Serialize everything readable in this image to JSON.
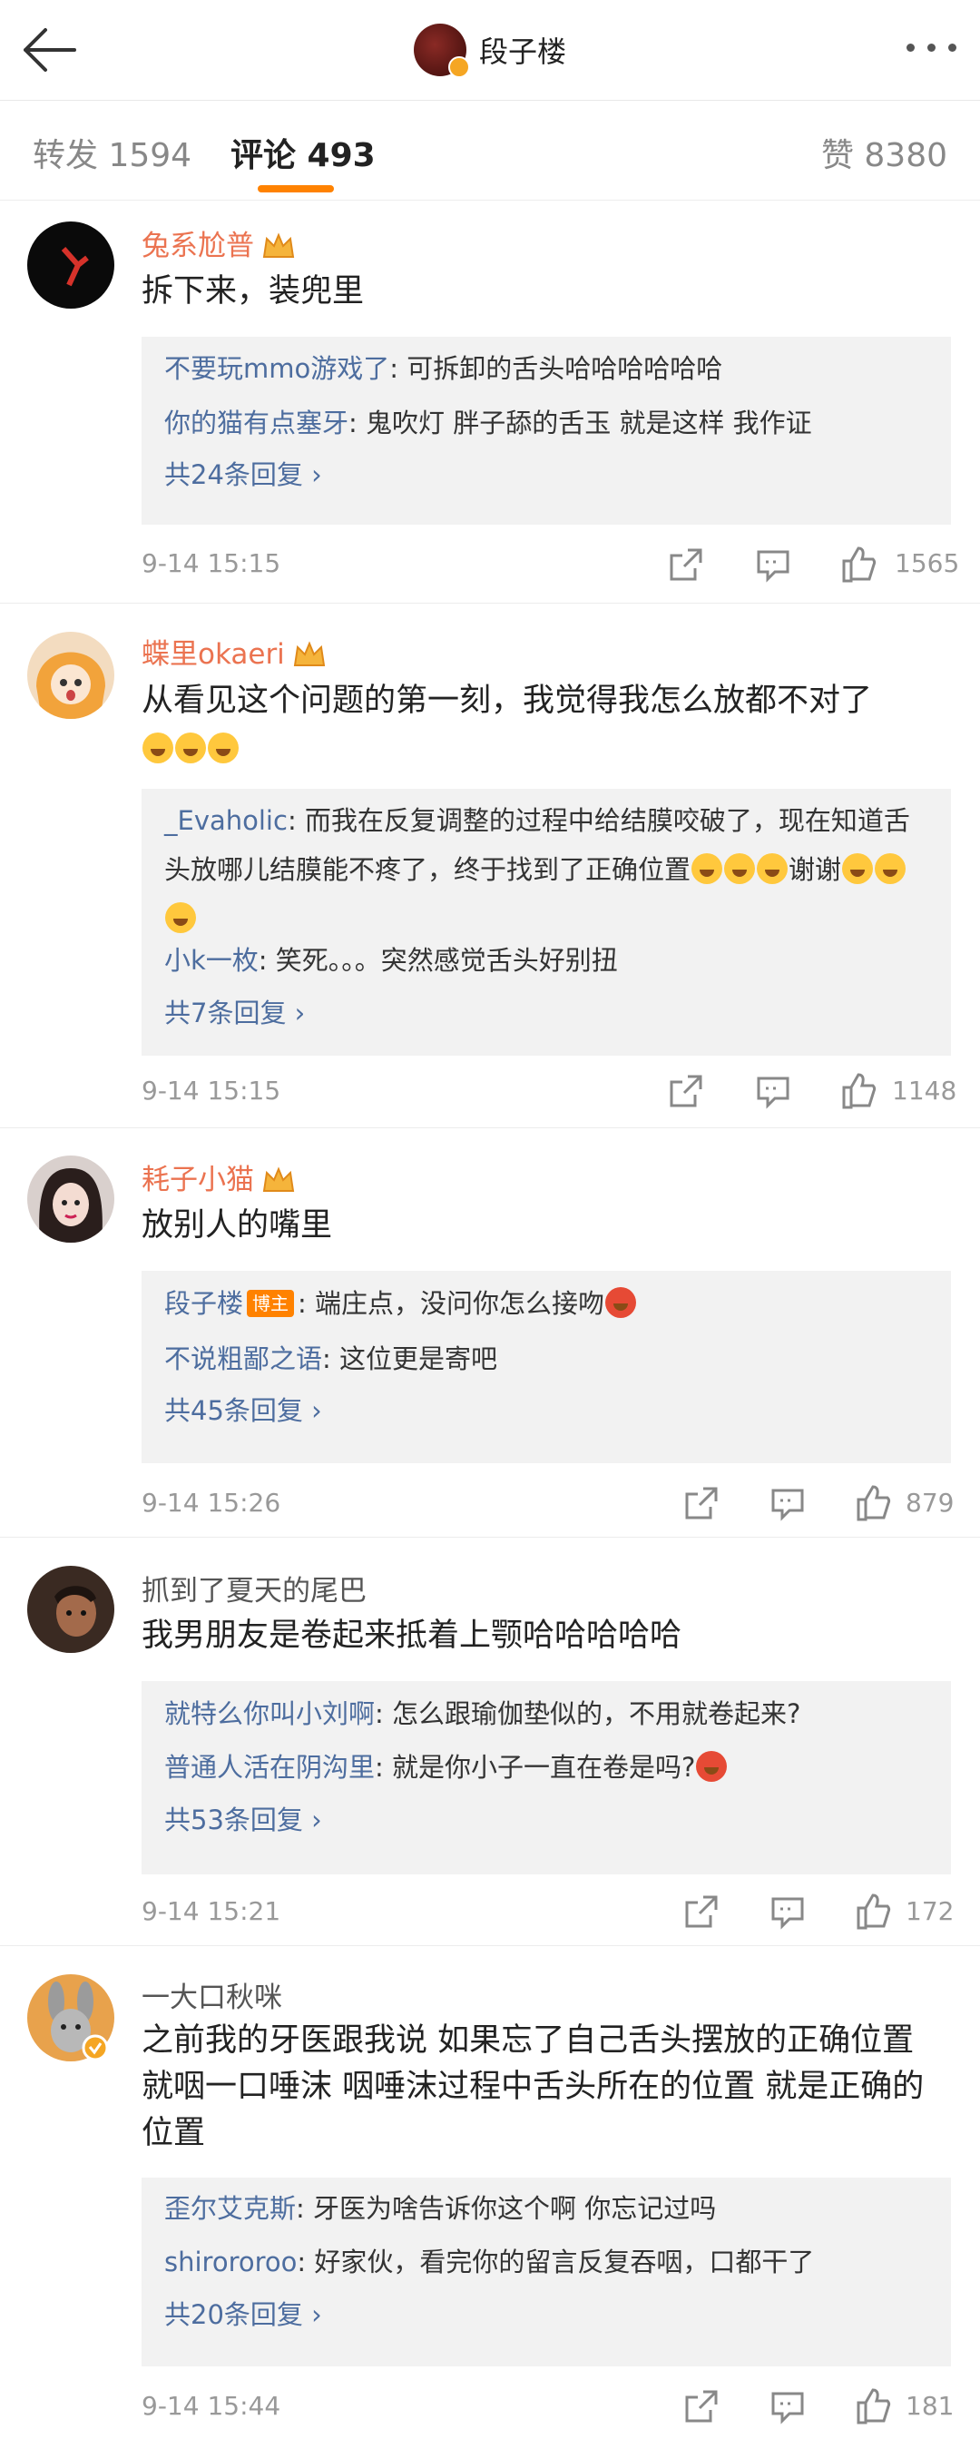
{
  "header": {
    "title": "段子楼"
  },
  "tabs": {
    "reposts": "转发 1594",
    "comments": "评论 493",
    "likes": "赞 8380"
  },
  "comments": [
    {
      "user": "兔系尬普",
      "text": "拆下来，装兜里",
      "replies": [
        {
          "name": "不要玩mmo游戏了",
          "text": ": 可拆卸的舌头哈哈哈哈哈哈"
        },
        {
          "name": "你的猫有点塞牙",
          "text": ": 鬼吹灯  胖子舔的舌玉 就是这样  我作证"
        }
      ],
      "more": "共24条回复 ›",
      "time": "9-14 15:15",
      "likes": "1565"
    },
    {
      "user": "蝶里okaeri",
      "text": "从看见这个问题的第一刻，我觉得我怎么放都不对了",
      "replies": [
        {
          "name": "_Evaholic",
          "text": ": 而我在反复调整的过程中给结膜咬破了，现在知道舌头放哪儿结膜能不疼了，终于找到了正确位置"
        },
        {
          "name": "小k一枚",
          "text": ": 笑死。。。突然感觉舌头好别扭"
        }
      ],
      "reply_tail": "谢谢",
      "more": "共7条回复 ›",
      "time": "9-14 15:15",
      "likes": "1148"
    },
    {
      "user": "耗子小猫",
      "text": "放别人的嘴里",
      "replies": [
        {
          "name": "段子楼",
          "badge": "博主",
          "text": ": 端庄点，没问你怎么接吻"
        },
        {
          "name": "不说粗鄙之语",
          "text": ": 这位更是寄吧"
        }
      ],
      "more": "共45条回复 ›",
      "time": "9-14 15:26",
      "likes": "879"
    },
    {
      "user": "抓到了夏天的尾巴",
      "text": "我男朋友是卷起来抵着上颚哈哈哈哈哈",
      "replies": [
        {
          "name": "就特么你叫小刘啊",
          "text": ": 怎么跟瑜伽垫似的，不用就卷起来?"
        },
        {
          "name": "普通人活在阴沟里",
          "text": ": 就是你小子一直在卷是吗?"
        }
      ],
      "more": "共53条回复 ›",
      "time": "9-14 15:21",
      "likes": "172"
    },
    {
      "user": "一大口秋咪",
      "text": "之前我的牙医跟我说 如果忘了自己舌头摆放的正确位置 就咽一口唾沫 咽唾沫过程中舌头所在的位置 就是正确的位置",
      "replies": [
        {
          "name": "歪尔艾克斯",
          "text": ": 牙医为啥告诉你这个啊 你忘记过吗"
        },
        {
          "name": "shirororoo",
          "text": ": 好家伙，看完你的留言反复吞咽，口都干了"
        }
      ],
      "more": "共20条回复 ›",
      "time": "9-14 15:44",
      "likes": "181"
    }
  ],
  "colors": {
    "accent": "#ff8200",
    "username": "#eb7350",
    "reply_name": "#4d6d9f"
  }
}
